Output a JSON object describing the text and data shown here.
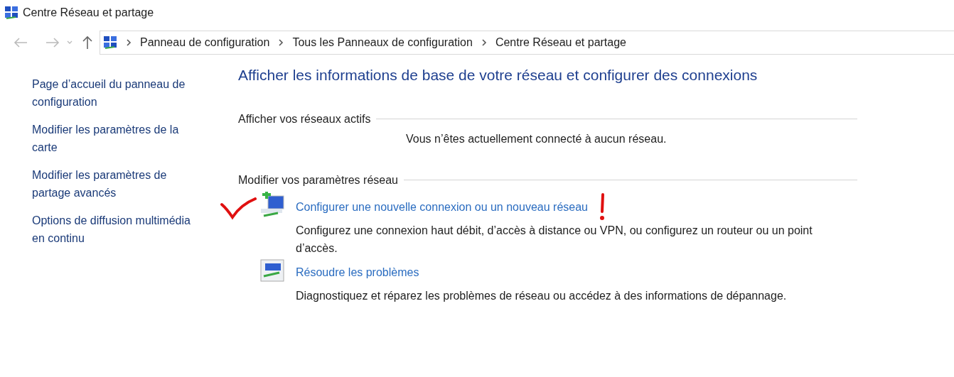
{
  "window": {
    "title": "Centre Réseau et partage"
  },
  "breadcrumbs": [
    "Panneau de configuration",
    "Tous les Panneaux de configuration",
    "Centre Réseau et partage"
  ],
  "sidebar": {
    "links": [
      "Page d’accueil du panneau de configuration",
      "Modifier les paramètres de la carte",
      "Modifier les paramètres de partage avancés",
      "Options de diffusion multimédia en continu"
    ]
  },
  "heading": "Afficher les informations de base de votre réseau et configurer des connexions",
  "active_networks": {
    "title": "Afficher vos réseaux actifs",
    "message": "Vous n’êtes actuellement connecté à aucun réseau."
  },
  "settings": {
    "title": "Modifier vos paramètres réseau",
    "tasks": [
      {
        "kind": "new",
        "link": "Configurer une nouvelle connexion ou un nouveau réseau",
        "description": "Configurez une connexion haut débit, d’accès à distance ou VPN, ou configurez un routeur ou un point d’accès.",
        "annotated": true
      },
      {
        "kind": "troubleshoot",
        "link": "Résoudre les problèmes",
        "description": "Diagnostiquez et réparez les problèmes de réseau ou accédez à des informations de dépannage.",
        "annotated": false
      }
    ]
  }
}
